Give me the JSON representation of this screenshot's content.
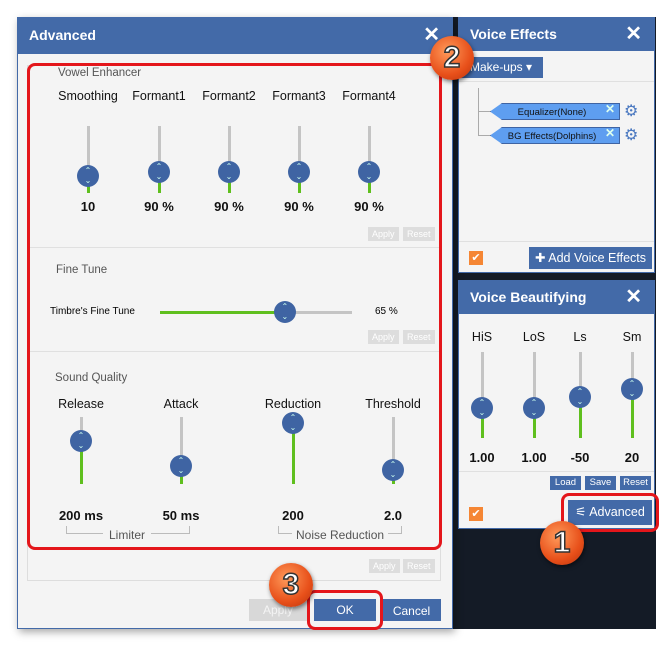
{
  "advanced": {
    "title": "Advanced",
    "vowel": {
      "title": "Vowel Enhancer",
      "sliders": [
        {
          "label": "Smoothing",
          "value": "10",
          "level": 0.25
        },
        {
          "label": "Formant1",
          "value": "90 %",
          "level": 0.32
        },
        {
          "label": "Formant2",
          "value": "90 %",
          "level": 0.32
        },
        {
          "label": "Formant3",
          "value": "90 %",
          "level": 0.32
        },
        {
          "label": "Formant4",
          "value": "90 %",
          "level": 0.32
        }
      ],
      "apply": "Apply",
      "reset": "Reset"
    },
    "fine": {
      "title": "Fine Tune",
      "label": "Timbre's Fine Tune",
      "value": "65 %",
      "level": 0.65,
      "apply": "Apply",
      "reset": "Reset"
    },
    "sound": {
      "title": "Sound Quality",
      "sliders": [
        {
          "label": "Release",
          "value": "200 ms",
          "level": 0.64
        },
        {
          "label": "Attack",
          "value": "50 ms",
          "level": 0.27
        },
        {
          "label": "Reduction",
          "value": "200",
          "level": 0.91
        },
        {
          "label": "Threshold",
          "value": "2.0",
          "level": 0.21
        }
      ],
      "group1": "Limiter",
      "group2": "Noise Reduction",
      "apply": "Apply",
      "reset": "Reset"
    },
    "buttons": {
      "apply": "Apply",
      "ok": "OK",
      "cancel": "Cancel"
    }
  },
  "voice_effects": {
    "title": "Voice Effects",
    "dropdown": "Make-ups",
    "effects": [
      "Equalizer(None)",
      "BG Effects(Dolphins)"
    ],
    "add": "Add Voice Effects"
  },
  "voice_beautifying": {
    "title": "Voice Beautifying",
    "sliders": [
      {
        "label": "HiS",
        "value": "1.00",
        "level": 0.35
      },
      {
        "label": "LoS",
        "value": "1.00",
        "level": 0.35
      },
      {
        "label": "Ls",
        "value": "-50",
        "level": 0.48
      },
      {
        "label": "Sm",
        "value": "20",
        "level": 0.57
      }
    ],
    "load": "Load",
    "save": "Save",
    "reset": "Reset",
    "advanced": "Advanced"
  },
  "badges": [
    "1",
    "2",
    "3"
  ],
  "colors": {
    "accent": "#436aa8",
    "fill": "#5fbf1e",
    "highlight": "#e4161b",
    "checkbox": "#f58634"
  }
}
